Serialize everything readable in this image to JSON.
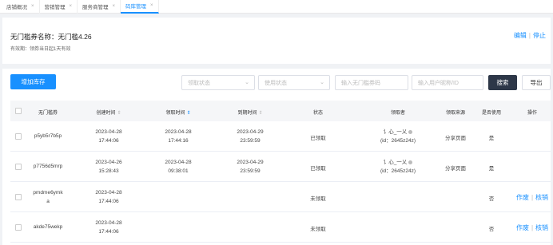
{
  "tabs": [
    {
      "label": "店铺概况",
      "close": "×",
      "active": false
    },
    {
      "label": "营销管理",
      "close": "×",
      "active": false
    },
    {
      "label": "服务商管理",
      "close": "×",
      "active": false
    },
    {
      "label": "码库管理",
      "close": "×",
      "active": true
    }
  ],
  "info": {
    "name": "无门槛券名称：无门槛4.26",
    "validity": "有效期：领券当日起1天有效",
    "edit": "编辑",
    "separator": "|",
    "stop": "停止"
  },
  "toolbar": {
    "add_label": "增加库存",
    "claim_status_placeholder": "领取状态",
    "use_status_placeholder": "使用状态",
    "coupon_code_placeholder": "输入无门槛券码",
    "user_placeholder": "输入用户昵称/ID",
    "search_label": "搜索",
    "export_label": "导出",
    "caret": "⌄"
  },
  "table": {
    "headers": {
      "code": "无门槛券",
      "created": "创建时间",
      "claimed": "领取时间",
      "expire": "到期时间",
      "status": "状态",
      "claimer": "领取者",
      "source": "领取来源",
      "used": "是否使用",
      "ops": "操作"
    },
    "sort_glyph": "⇕",
    "rows": [
      {
        "code": "p5yb5r7b5p",
        "code2": "",
        "created_date": "2023-04-28",
        "created_time": "17:44:06",
        "claimed_date": "2023-04-28",
        "claimed_time": "17:44:16",
        "expire_date": "2023-04-29",
        "expire_time": "23:59:59",
        "status": "已领取",
        "user_name": "讠心_一乂",
        "user_id": "(id：2645z24z)",
        "source": "分享页面",
        "used": "是",
        "op1": "",
        "op2": ""
      },
      {
        "code": "p7756d5mrp",
        "code2": "",
        "created_date": "2023-04-26",
        "created_time": "15:28:43",
        "claimed_date": "2023-04-28",
        "claimed_time": "09:38:01",
        "expire_date": "2023-04-29",
        "expire_time": "23:59:59",
        "status": "已领取",
        "user_name": "讠心_一乂",
        "user_id": "(id：2645z24z)",
        "source": "分享页面",
        "used": "是",
        "op1": "",
        "op2": ""
      },
      {
        "code": "pmdme6ymk",
        "code2": "a",
        "created_date": "2023-04-28",
        "created_time": "17:44:06",
        "claimed_date": "",
        "claimed_time": "",
        "expire_date": "",
        "expire_time": "",
        "status": "未领取",
        "user_name": "",
        "user_id": "",
        "source": "",
        "used": "否",
        "op1": "作废",
        "op2": "核销"
      },
      {
        "code": "akde75wekp",
        "code2": "",
        "created_date": "2023-04-28",
        "created_time": "17:44:06",
        "claimed_date": "",
        "claimed_time": "",
        "expire_date": "",
        "expire_time": "",
        "status": "未领取",
        "user_name": "",
        "user_id": "",
        "source": "",
        "used": "否",
        "op1": "作废",
        "op2": "核销"
      }
    ]
  },
  "colors": {
    "accent": "#1890ff",
    "search_bg": "#2d3748"
  }
}
